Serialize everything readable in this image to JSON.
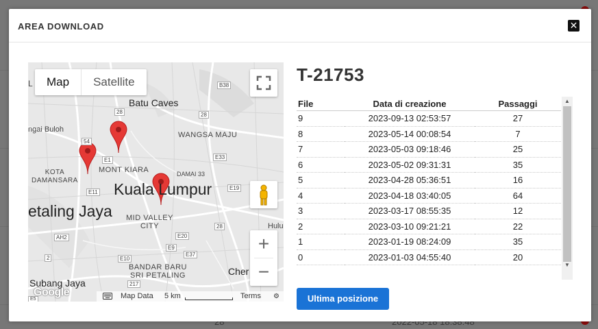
{
  "background": {
    "row_value": "28",
    "row_date": "2022-05-18 18:38:48"
  },
  "modal": {
    "title": "AREA DOWNLOAD",
    "close_symbol": "✕"
  },
  "map": {
    "type_map": "Map",
    "type_satellite": "Satellite",
    "labels": {
      "batu_caves": "Batu Caves",
      "sungai_buloh": "ngai Buloh",
      "wangsa_maju": "WANGSA MAJU",
      "mont_kiara": "MONT KIARA",
      "kota_damansara": "KOTA\nDAMANSARA",
      "damai": "DAMAI 33",
      "kuala_lumpur": "Kuala Lumpur",
      "petaling_jaya": "etaling Jaya",
      "mid_valley": "MID VALLEY\nCITY",
      "hulu": "Hulu",
      "bandar_baru": "BANDAR BARU\nSRI PETALING",
      "cheras": "Cher",
      "subang_jaya": "Subang Jaya",
      "l_left": "L"
    },
    "road_badges": [
      "B38",
      "28",
      "28",
      "54",
      "E1",
      "E33",
      "E11",
      "E19",
      "28",
      "AH2",
      "E20",
      "E37",
      "2",
      "E10",
      "E9",
      "217",
      "E5"
    ],
    "google": "Google",
    "footer": {
      "data": "Map Data",
      "scale": "5 km",
      "terms": "Terms"
    },
    "icons": [
      "fullscreen-icon",
      "pegman-icon",
      "keyboard-icon"
    ],
    "zoom_in": "+",
    "zoom_out": "−"
  },
  "panel": {
    "title": "T-21753",
    "columns": [
      "File",
      "Data di creazione",
      "Passaggi"
    ],
    "rows": [
      [
        "9",
        "2023-09-13 02:53:57",
        "27"
      ],
      [
        "8",
        "2023-05-14 00:08:54",
        "7"
      ],
      [
        "7",
        "2023-05-03 09:18:46",
        "25"
      ],
      [
        "6",
        "2023-05-02 09:31:31",
        "35"
      ],
      [
        "5",
        "2023-04-28 05:36:51",
        "16"
      ],
      [
        "4",
        "2023-04-18 03:40:05",
        "64"
      ],
      [
        "3",
        "2023-03-17 08:55:35",
        "12"
      ],
      [
        "2",
        "2023-03-10 09:21:21",
        "22"
      ],
      [
        "1",
        "2023-01-19 08:24:09",
        "35"
      ],
      [
        "0",
        "2023-01-03 04:55:40",
        "20"
      ]
    ],
    "button": "Ultima posizione"
  },
  "colors": {
    "accent": "#1a73d6",
    "marker": "#e53935"
  }
}
